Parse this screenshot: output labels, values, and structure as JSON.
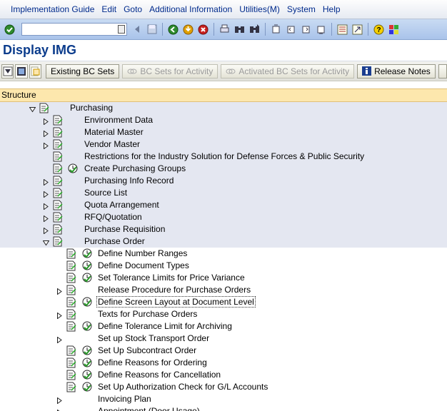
{
  "menu": [
    "Implementation Guide",
    "Edit",
    "Goto",
    "Additional Information",
    "Utilities(M)",
    "System",
    "Help"
  ],
  "command_field": {
    "value": ""
  },
  "toolbar_icons": [
    "enter-icon",
    "back-icon",
    "exit-icon",
    "cancel-icon",
    "print-icon",
    "find-icon",
    "find-next-icon",
    "first-page-icon",
    "prev-page-icon",
    "next-page-icon",
    "last-page-icon",
    "new-session-icon",
    "shortcut-icon",
    "help-icon",
    "layout-icon"
  ],
  "title": "Display IMG",
  "app_toolbar": {
    "existing_bc_sets": "Existing BC Sets",
    "bc_sets_for_activity": "BC Sets for Activity",
    "activated_bc_sets": "Activated BC Sets for Activity",
    "release_notes": "Release Notes"
  },
  "structure_header": "Structure",
  "tree": [
    {
      "label": "Purchasing",
      "level": 0,
      "expander": "expanded",
      "clock": false,
      "shaded": true
    },
    {
      "label": "Environment Data",
      "level": 1,
      "expander": "collapsed",
      "clock": false,
      "shaded": true
    },
    {
      "label": "Material Master",
      "level": 1,
      "expander": "collapsed",
      "clock": false,
      "shaded": true
    },
    {
      "label": "Vendor Master",
      "level": 1,
      "expander": "collapsed",
      "clock": false,
      "shaded": true
    },
    {
      "label": "Restrictions for the Industry Solution for Defense Forces & Public Security",
      "level": 1,
      "expander": "none",
      "clock": false,
      "shaded": true
    },
    {
      "label": "Create Purchasing Groups",
      "level": 1,
      "expander": "none",
      "clock": true,
      "shaded": true
    },
    {
      "label": "Purchasing Info Record",
      "level": 1,
      "expander": "collapsed",
      "clock": false,
      "shaded": true
    },
    {
      "label": "Source List",
      "level": 1,
      "expander": "collapsed",
      "clock": false,
      "shaded": true
    },
    {
      "label": "Quota Arrangement",
      "level": 1,
      "expander": "collapsed",
      "clock": false,
      "shaded": true
    },
    {
      "label": "RFQ/Quotation",
      "level": 1,
      "expander": "collapsed",
      "clock": false,
      "shaded": true
    },
    {
      "label": "Purchase Requisition",
      "level": 1,
      "expander": "collapsed",
      "clock": false,
      "shaded": true
    },
    {
      "label": "Purchase Order",
      "level": 1,
      "expander": "expanded",
      "clock": false,
      "shaded": true
    },
    {
      "label": "Define Number Ranges",
      "level": 2,
      "expander": "none",
      "clock": true,
      "shaded": false
    },
    {
      "label": "Define Document Types",
      "level": 2,
      "expander": "none",
      "clock": true,
      "shaded": false
    },
    {
      "label": "Set Tolerance Limits for Price Variance",
      "level": 2,
      "expander": "none",
      "clock": true,
      "shaded": false
    },
    {
      "label": "Release Procedure for Purchase Orders",
      "level": 2,
      "expander": "collapsed",
      "clock": false,
      "shaded": false
    },
    {
      "label": "Define Screen Layout at Document Level",
      "level": 2,
      "expander": "none",
      "clock": true,
      "shaded": false,
      "focused": true
    },
    {
      "label": "Texts for Purchase Orders",
      "level": 2,
      "expander": "collapsed",
      "clock": false,
      "shaded": false
    },
    {
      "label": "Define Tolerance Limit for Archiving",
      "level": 2,
      "expander": "none",
      "clock": true,
      "shaded": false
    },
    {
      "label": "Set up Stock Transport Order",
      "level": 2,
      "expander": "collapsed",
      "clock": false,
      "shaded": false,
      "nodoc": true
    },
    {
      "label": "Set Up Subcontract Order",
      "level": 2,
      "expander": "none",
      "clock": true,
      "shaded": false
    },
    {
      "label": "Define Reasons for Ordering",
      "level": 2,
      "expander": "none",
      "clock": true,
      "shaded": false
    },
    {
      "label": "Define Reasons for Cancellation",
      "level": 2,
      "expander": "none",
      "clock": true,
      "shaded": false
    },
    {
      "label": "Set Up Authorization Check for G/L Accounts",
      "level": 2,
      "expander": "none",
      "clock": true,
      "shaded": false
    },
    {
      "label": "Invoicing Plan",
      "level": 2,
      "expander": "collapsed",
      "clock": false,
      "shaded": false,
      "nodoc": true
    },
    {
      "label": "Appointment (Door Usage)",
      "level": 2,
      "expander": "collapsed",
      "clock": false,
      "shaded": false,
      "nodoc": true
    }
  ]
}
